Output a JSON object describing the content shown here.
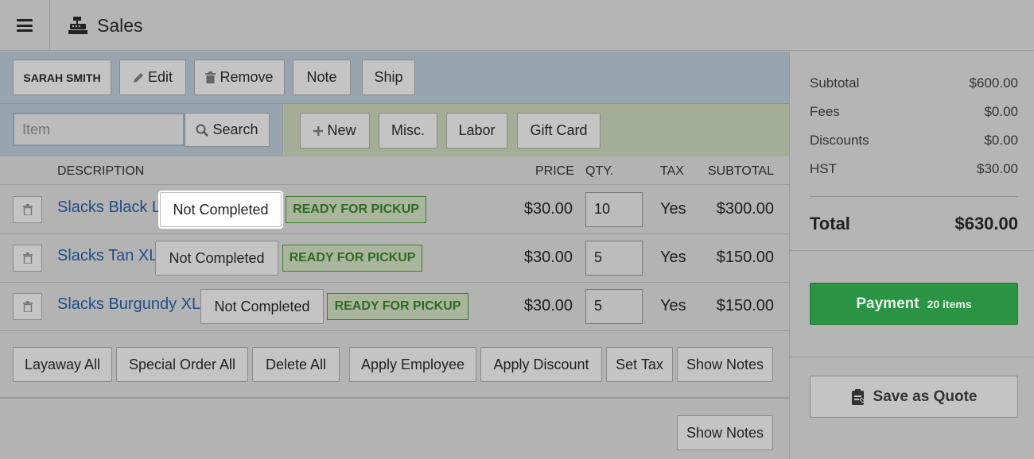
{
  "header": {
    "title": "Sales",
    "menu_icon": "hamburger-icon",
    "register_icon": "cash-register-icon"
  },
  "customer_bar": {
    "customer_name": "SARAH SMITH",
    "edit_label": "Edit",
    "remove_label": "Remove",
    "note_label": "Note",
    "ship_label": "Ship"
  },
  "item_bar": {
    "item_placeholder": "Item",
    "search_label": "Search",
    "new_label": "New",
    "misc_label": "Misc.",
    "labor_label": "Labor",
    "gift_card_label": "Gift Card"
  },
  "table": {
    "headers": {
      "description": "DESCRIPTION",
      "price": "PRICE",
      "qty": "QTY.",
      "tax": "TAX",
      "subtotal": "SUBTOTAL"
    },
    "rows": [
      {
        "description": "Slacks Black L",
        "status": "Not Completed",
        "badge": "READY FOR PICKUP",
        "price": "$30.00",
        "qty": "10",
        "tax": "Yes",
        "subtotal": "$300.00"
      },
      {
        "description": "Slacks Tan XL",
        "status": "Not Completed",
        "badge": "READY FOR PICKUP",
        "price": "$30.00",
        "qty": "5",
        "tax": "Yes",
        "subtotal": "$150.00"
      },
      {
        "description": "Slacks Burgundy XL",
        "status": "Not Completed",
        "badge": "READY FOR PICKUP",
        "price": "$30.00",
        "qty": "5",
        "tax": "Yes",
        "subtotal": "$150.00"
      }
    ]
  },
  "actions": {
    "layaway_all": "Layaway All",
    "special_order_all": "Special Order All",
    "delete_all": "Delete All",
    "apply_employee": "Apply Employee",
    "apply_discount": "Apply Discount",
    "set_tax": "Set Tax",
    "show_notes": "Show Notes",
    "show_notes_bottom": "Show Notes"
  },
  "summary": {
    "subtotal_label": "Subtotal",
    "subtotal": "$600.00",
    "fees_label": "Fees",
    "fees": "$0.00",
    "discounts_label": "Discounts",
    "discounts": "$0.00",
    "hst_label": "HST",
    "hst": "$30.00",
    "total_label": "Total",
    "total": "$630.00",
    "payment_label": "Payment",
    "payment_count": "20 items",
    "save_quote_label": "Save as Quote"
  },
  "colors": {
    "payment_green": "#2a9444",
    "link_blue": "#214d86",
    "badge_green": "#2f6b23"
  }
}
